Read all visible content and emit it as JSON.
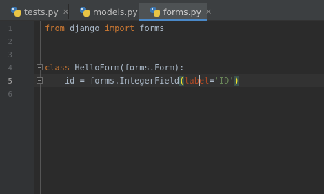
{
  "tabs": [
    {
      "label": "tests.py",
      "close": "✕",
      "active": false
    },
    {
      "label": "models.py",
      "close": "✕",
      "active": false
    },
    {
      "label": "forms.py",
      "close": "✕",
      "active": true
    }
  ],
  "editor": {
    "line_numbers": [
      "1",
      "2",
      "3",
      "4",
      "5",
      "6"
    ],
    "current_line": "5",
    "lines": [
      {
        "tokens": [
          {
            "t": "kw",
            "v": "from"
          },
          {
            "t": "plain",
            "v": " django "
          },
          {
            "t": "kw",
            "v": "import"
          },
          {
            "t": "plain",
            "v": " forms"
          }
        ]
      },
      {
        "tokens": []
      },
      {
        "tokens": []
      },
      {
        "tokens": [
          {
            "t": "kw",
            "v": "class"
          },
          {
            "t": "plain",
            "v": " HelloForm(forms.Form):"
          }
        ]
      },
      {
        "tokens": [
          {
            "t": "plain",
            "v": "    id = forms.IntegerField"
          },
          {
            "t": "paren",
            "v": "("
          },
          {
            "t": "param",
            "v": "label"
          },
          {
            "t": "plain",
            "v": "="
          },
          {
            "t": "str",
            "v": "'ID'"
          },
          {
            "t": "paren",
            "v": ")"
          }
        ]
      },
      {
        "tokens": []
      }
    ]
  },
  "colors": {
    "keyword": "#cc7832",
    "string": "#6a8759",
    "param": "#aa4926",
    "text": "#a9b7c6",
    "tab_accent": "#4a88c7"
  },
  "icons": {
    "tab_icon": "python-file-icon",
    "fold_icon": "fold-marker-icon"
  }
}
